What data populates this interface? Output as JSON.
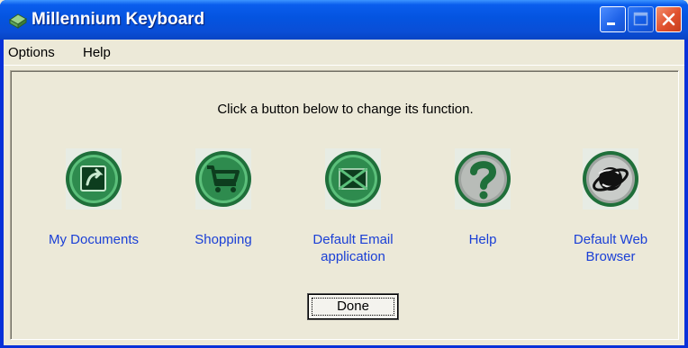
{
  "window": {
    "title": "Millennium Keyboard",
    "controls": [
      "minimize-icon",
      "maximize-icon",
      "close-icon"
    ]
  },
  "menu": {
    "items": [
      {
        "label": "Options"
      },
      {
        "label": "Help"
      }
    ]
  },
  "main": {
    "instruction": "Click a button below to change its function.",
    "buttons": [
      {
        "label_line1": "My Documents",
        "label_line2": "",
        "icon": "my-documents-icon"
      },
      {
        "label_line1": "Shopping",
        "label_line2": "",
        "icon": "shopping-cart-icon"
      },
      {
        "label_line1": "Default Email",
        "label_line2": "application",
        "icon": "email-icon"
      },
      {
        "label_line1": "Help",
        "label_line2": "",
        "icon": "help-icon"
      },
      {
        "label_line1": "Default Web",
        "label_line2": "Browser",
        "icon": "web-browser-icon"
      }
    ],
    "done_label": "Done"
  },
  "colors": {
    "titlebar": "#0a5ded",
    "link_text": "#1a3fd6",
    "icon_green": "#1a7a3a",
    "window_bg": "#ece9d8"
  }
}
